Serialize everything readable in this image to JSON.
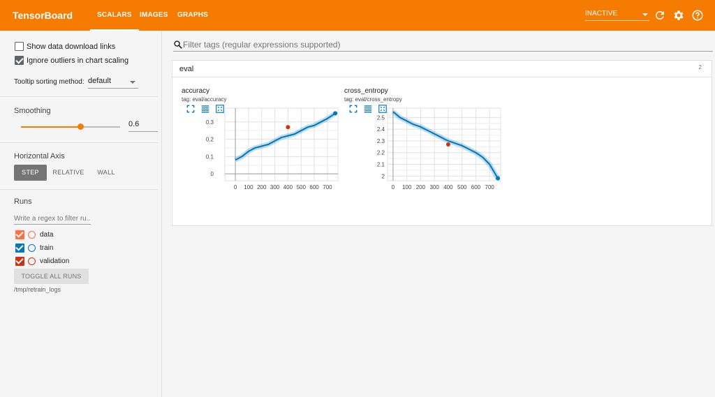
{
  "header": {
    "brand": "TensorBoard",
    "tabs": [
      {
        "label": "SCALARS",
        "active": true
      },
      {
        "label": "IMAGES",
        "active": false
      },
      {
        "label": "GRAPHS",
        "active": false
      }
    ],
    "status": "INACTIVE",
    "icons": [
      "refresh-icon",
      "settings-icon",
      "help-icon"
    ],
    "accent_color": "#f57c00"
  },
  "sidebar": {
    "options": [
      {
        "label": "Show data download links",
        "checked": false
      },
      {
        "label": "Ignore outliers in chart scaling",
        "checked": true
      }
    ],
    "tooltip_label": "Tooltip sorting method:",
    "tooltip_value": "default",
    "smoothing_title": "Smoothing",
    "smoothing_value": "0.6",
    "smoothing_fraction": 0.6,
    "axis_title": "Horizontal Axis",
    "axis_buttons": [
      "STEP",
      "RELATIVE",
      "WALL"
    ],
    "axis_active": "STEP",
    "runs_title": "Runs",
    "runs_filter_placeholder": "Write a regex to filter ru...",
    "runs": [
      {
        "name": "data",
        "color": "#ff7043",
        "checked": true
      },
      {
        "name": "train",
        "color": "#0077bb",
        "checked": true
      },
      {
        "name": "validation",
        "color": "#cc3311",
        "checked": true
      }
    ],
    "toggle_label": "TOGGLE ALL RUNS",
    "logdir": "/tmp/retrain_logs"
  },
  "main": {
    "filter_placeholder": "Filter tags (regular expressions supported)",
    "card_title": "eval",
    "card_count": "2"
  },
  "chart_data": [
    {
      "type": "line",
      "title": "accuracy",
      "tag": "tag: eval/accuracy",
      "x_ticks": [
        "0",
        "100",
        "200",
        "300",
        "400",
        "500",
        "600",
        "700"
      ],
      "y_ticks": [
        "0",
        "0.1",
        "0.2",
        "0.3"
      ],
      "xlim": [
        -80,
        780
      ],
      "ylim": [
        -0.04,
        0.38
      ],
      "series": [
        {
          "name": "train",
          "color": "#0077bb",
          "x": [
            0,
            50,
            100,
            150,
            200,
            250,
            300,
            350,
            400,
            450,
            500,
            550,
            600,
            650,
            700,
            760
          ],
          "y": [
            0.08,
            0.1,
            0.13,
            0.15,
            0.16,
            0.17,
            0.19,
            0.21,
            0.22,
            0.23,
            0.25,
            0.27,
            0.28,
            0.3,
            0.32,
            0.35
          ]
        },
        {
          "name": "validation",
          "color": "#cc3311",
          "x": [
            400
          ],
          "y": [
            0.27
          ]
        }
      ]
    },
    {
      "type": "line",
      "title": "cross_entropy",
      "tag": "tag: eval/cross_entropy",
      "x_ticks": [
        "0",
        "100",
        "200",
        "300",
        "400",
        "500",
        "600",
        "700"
      ],
      "y_ticks": [
        "2",
        "2.1",
        "2.2",
        "2.3",
        "2.4",
        "2.5"
      ],
      "xlim": [
        -40,
        780
      ],
      "ylim": [
        1.96,
        2.58
      ],
      "series": [
        {
          "name": "train",
          "color": "#0077bb",
          "x": [
            0,
            50,
            100,
            150,
            200,
            250,
            300,
            350,
            400,
            450,
            500,
            550,
            600,
            650,
            700,
            760
          ],
          "y": [
            2.55,
            2.5,
            2.47,
            2.44,
            2.42,
            2.39,
            2.36,
            2.33,
            2.3,
            2.28,
            2.26,
            2.23,
            2.2,
            2.16,
            2.1,
            1.98
          ]
        },
        {
          "name": "validation",
          "color": "#cc3311",
          "x": [
            400
          ],
          "y": [
            2.27
          ]
        }
      ]
    }
  ]
}
